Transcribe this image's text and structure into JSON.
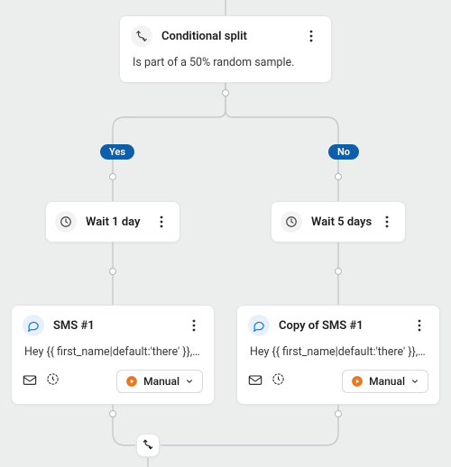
{
  "top": {
    "title": "Conditional split",
    "description": "Is part of a 50% random sample."
  },
  "branches": {
    "yes": "Yes",
    "no": "No"
  },
  "wait": {
    "left": "Wait 1 day",
    "right": "Wait 5 days"
  },
  "sms": {
    "left": {
      "title": "SMS #1",
      "preview": "Hey {{ first_name|default:'there' }}, it's be...",
      "mode": "Manual"
    },
    "right": {
      "title": "Copy of SMS #1",
      "preview": "Hey {{ first_name|default:'there' }}, it's be...",
      "mode": "Manual"
    }
  }
}
